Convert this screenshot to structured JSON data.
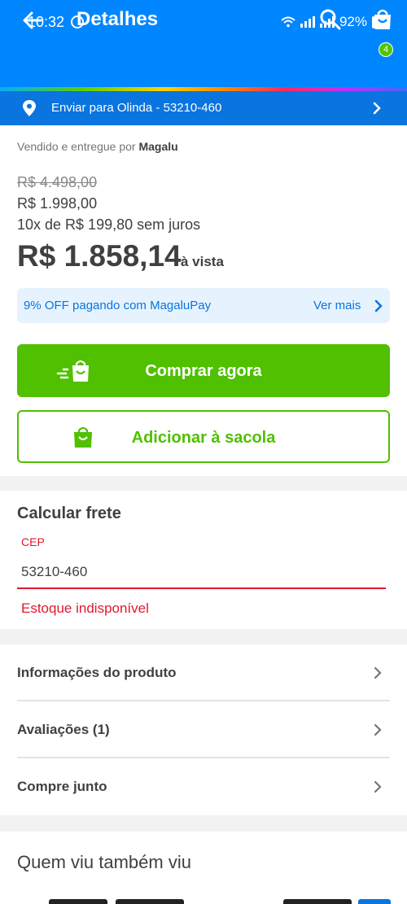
{
  "status": {
    "time": "10:32",
    "battery": "92%"
  },
  "header": {
    "title": "Detalhes",
    "cart_count": "4"
  },
  "shipping": {
    "label": "Enviar para Olinda - 53210-460"
  },
  "product": {
    "seller_prefix": "Vendido e entregue por",
    "seller_name": "Magalu",
    "old_price": "R$ 4.498,00",
    "price_mid": "R$ 1.998,00",
    "installments": "10x de R$ 199,80 sem juros",
    "cash_price": "R$ 1.858,14",
    "cash_suffix": "à vista"
  },
  "promo": {
    "text": "9% OFF pagando com MagaluPay",
    "link": "Ver mais"
  },
  "actions": {
    "buy_label": "Comprar agora",
    "add_label": "Adicionar à sacola"
  },
  "freight": {
    "title": "Calcular frete",
    "cep_label": "CEP",
    "cep_value": "53210-460",
    "error": "Estoque indisponível"
  },
  "info_rows": [
    {
      "label": "Informações do produto"
    },
    {
      "label": "Avaliações (1)"
    },
    {
      "label": "Compre junto"
    }
  ],
  "related": {
    "title": "Quem viu também viu"
  },
  "colors": {
    "primary": "#0086ff",
    "ship_bar": "#0a74df",
    "green": "#50c000",
    "error": "#e0182d"
  }
}
